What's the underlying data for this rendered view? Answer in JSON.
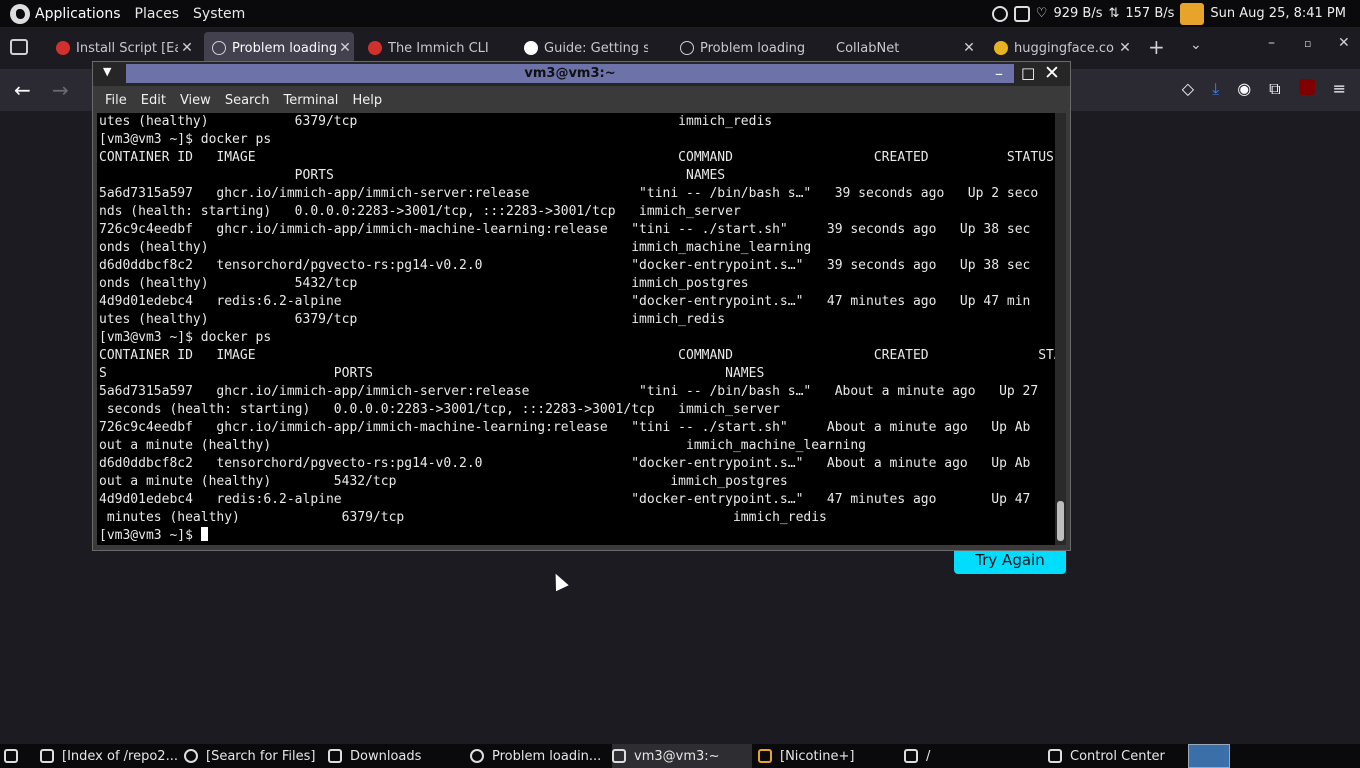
{
  "top_panel": {
    "applications": "Applications",
    "places": "Places",
    "system": "System",
    "download_speed": "929 B/s",
    "upload_speed": "157 B/s",
    "clock": "Sun Aug 25,  8:41 PM"
  },
  "browser": {
    "tabs": [
      {
        "label": "Install Script [Ea",
        "favicon_color": "#d0312d"
      },
      {
        "label": "Problem loading",
        "favicon_color": "#cfcfd8"
      },
      {
        "label": "The Immich CLI",
        "favicon_color": "#d0312d"
      },
      {
        "label": "Guide: Getting s",
        "favicon_color": "#ffffff"
      },
      {
        "label": "Problem loading",
        "favicon_color": "#cfcfd8"
      },
      {
        "label": "CollabNet",
        "favicon_color": "#1c1b22"
      },
      {
        "label": "huggingface.co",
        "favicon_color": "#e6b422"
      }
    ],
    "new_tab": "+",
    "try_again": "Try Again"
  },
  "terminal": {
    "title": "vm3@vm3:~",
    "menu": [
      "File",
      "Edit",
      "View",
      "Search",
      "Terminal",
      "Help"
    ],
    "lines": [
      "utes (healthy)           6379/tcp                                         immich_redis",
      "[vm3@vm3 ~]$ docker ps",
      "CONTAINER ID   IMAGE                                                      COMMAND                  CREATED          STATUS",
      "                         PORTS                                             NAMES",
      "5a6d7315a597   ghcr.io/immich-app/immich-server:release              \"tini -- /bin/bash s…\"   39 seconds ago   Up 2 seco",
      "nds (health: starting)   0.0.0.0:2283->3001/tcp, :::2283->3001/tcp   immich_server",
      "726c9c4eedbf   ghcr.io/immich-app/immich-machine-learning:release   \"tini -- ./start.sh\"     39 seconds ago   Up 38 sec",
      "onds (healthy)                                                      immich_machine_learning",
      "d6d0ddbcf8c2   tensorchord/pgvecto-rs:pg14-v0.2.0                   \"docker-entrypoint.s…\"   39 seconds ago   Up 38 sec",
      "onds (healthy)           5432/tcp                                   immich_postgres",
      "4d9d01edebc4   redis:6.2-alpine                                     \"docker-entrypoint.s…\"   47 minutes ago   Up 47 min",
      "utes (healthy)           6379/tcp                                   immich_redis",
      "[vm3@vm3 ~]$ docker ps",
      "CONTAINER ID   IMAGE                                                      COMMAND                  CREATED              STATU",
      "S                             PORTS                                             NAMES",
      "5a6d7315a597   ghcr.io/immich-app/immich-server:release              \"tini -- /bin/bash s…\"   About a minute ago   Up 27",
      " seconds (health: starting)   0.0.0.0:2283->3001/tcp, :::2283->3001/tcp   immich_server",
      "726c9c4eedbf   ghcr.io/immich-app/immich-machine-learning:release   \"tini -- ./start.sh\"     About a minute ago   Up Ab",
      "out a minute (healthy)                                                     immich_machine_learning",
      "d6d0ddbcf8c2   tensorchord/pgvecto-rs:pg14-v0.2.0                   \"docker-entrypoint.s…\"   About a minute ago   Up Ab",
      "out a minute (healthy)        5432/tcp                                   immich_postgres",
      "4d9d01edebc4   redis:6.2-alpine                                     \"docker-entrypoint.s…\"   47 minutes ago       Up 47",
      " minutes (healthy)             6379/tcp                                          immich_redis"
    ],
    "prompt": "[vm3@vm3 ~]$ "
  },
  "taskbar": {
    "items": [
      "[Index of /repo2...",
      "[Search for Files]",
      "Downloads",
      "Problem loadin...",
      "vm3@vm3:~",
      "[Nicotine+]",
      "/",
      "Control Center"
    ]
  },
  "colors": {
    "accent_button": "#00ddff",
    "terminal_title_bar": "#6d72a8"
  }
}
